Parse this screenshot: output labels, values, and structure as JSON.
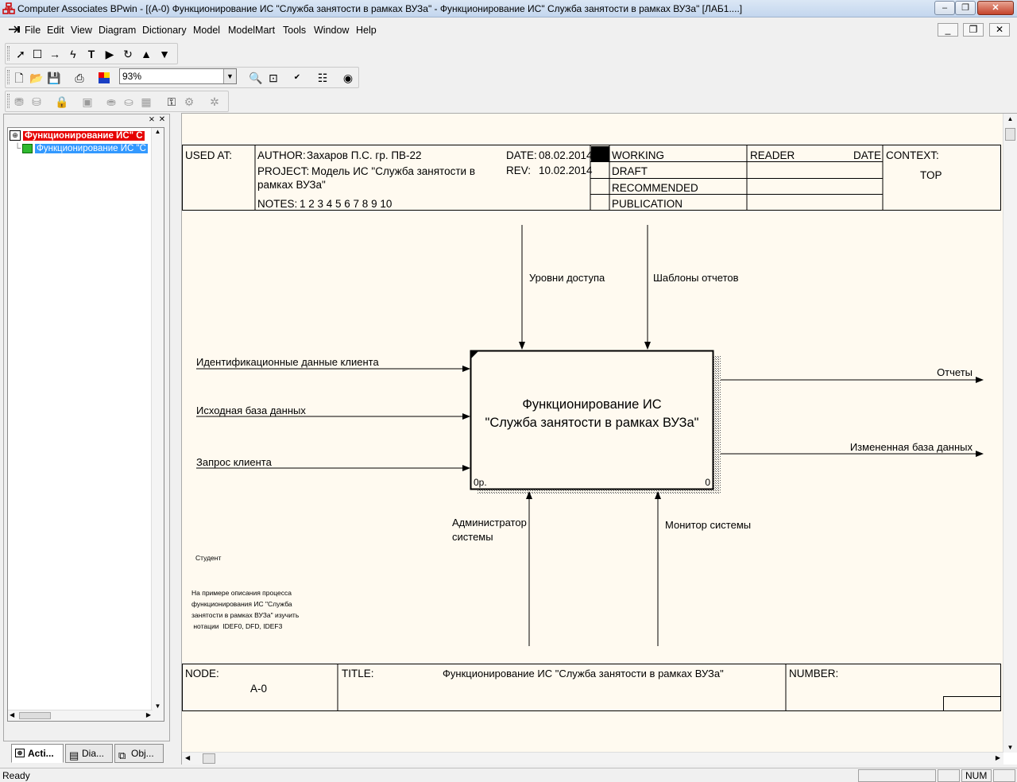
{
  "window": {
    "title": "Computer Associates BPwin - [(A-0) Функционирование ИС \"Служба занятости в рамках  ВУЗа\" - Функционирование ИС\" Служба  занятости  в рамках ВУЗа\"  [ЛАБ1....]"
  },
  "menu": {
    "items": [
      "File",
      "Edit",
      "View",
      "Diagram",
      "Dictionary",
      "Model",
      "ModelMart",
      "Tools",
      "Window",
      "Help"
    ]
  },
  "toolbar": {
    "zoom": "93%"
  },
  "explorer": {
    "root_label": "Функционирование ИС\" С",
    "child_label": "Функционирование ИС \"С",
    "tabs": [
      "Acti...",
      "Dia...",
      "Obj..."
    ]
  },
  "frame": {
    "used_at_label": "USED AT:",
    "author_label": "AUTHOR:",
    "author_value": "Захаров П.С. гр. ПВ-22",
    "project_label": "PROJECT:",
    "project_value_line1": "Модель ИС \"Служба занятости в",
    "project_value_line2": "рамках ВУЗа\"",
    "notes_label": "NOTES:",
    "notes_value": "1  2  3  4  5  6  7  8  9  10",
    "date_label": "DATE:",
    "date_value": "08.02.2014",
    "rev_label": "REV:",
    "rev_value": "10.02.2014",
    "status": [
      "WORKING",
      "DRAFT",
      "RECOMMENDED",
      "PUBLICATION"
    ],
    "reader_label": "READER",
    "reader_date_label": "DATE",
    "context_label": "CONTEXT:",
    "context_value": "TOP",
    "node_label": "NODE:",
    "node_value": "A-0",
    "title_label": "TITLE:",
    "title_value": "Функционирование ИС \"Служба занятости в рамках  ВУЗа\"",
    "number_label": "NUMBER:"
  },
  "diagram": {
    "activity_line1": "Функционирование ИС",
    "activity_line2": "\"Служба занятости в рамках  ВУЗа\"",
    "activity_cost": "0р.",
    "activity_number": "0",
    "controls": [
      "Уровни доступа",
      "Шаблоны отчетов"
    ],
    "inputs": [
      "Идентификационные данные клиента",
      "Исходная база данных",
      "Запрос клиента"
    ],
    "outputs": [
      "Отчеты",
      "Измененная база данных"
    ],
    "mechanisms": {
      "admin_line1": "Администратор",
      "admin_line2": "системы",
      "monitor": "Монитор системы"
    },
    "viewpoint": "Студент",
    "purpose_lines": [
      "На примере описания процесса",
      "функционирования  ИС \"Служба",
      "занятости в рамках  ВУЗа\"  изучить",
      " нотации  IDEF0, DFD, IDEF3"
    ]
  },
  "status": {
    "text": "Ready",
    "num": "NUM"
  }
}
